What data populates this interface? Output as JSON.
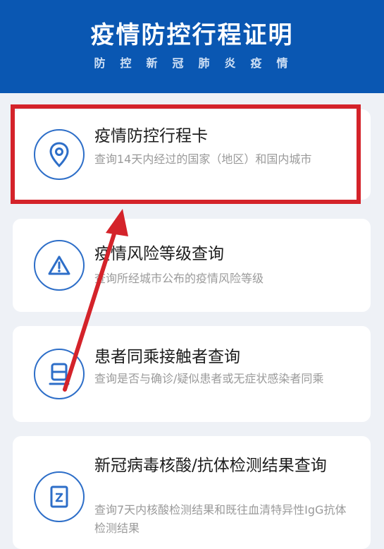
{
  "header": {
    "title": "疫情防控行程证明",
    "subtitle": "防控新冠肺炎疫情"
  },
  "cards": [
    {
      "title": "疫情防控行程卡",
      "desc": "查询14天内经过的国家（地区）和国内城市",
      "icon": "location-pin-icon"
    },
    {
      "title": "疫情风险等级查询",
      "desc": "查询所经城市公布的疫情风险等级",
      "icon": "warning-triangle-icon"
    },
    {
      "title": "患者同乘接触者查询",
      "desc": "查询是否与确诊/疑似患者或无症状感染者同乘",
      "icon": "train-icon"
    },
    {
      "title": "新冠病毒核酸/抗体检测结果查询",
      "desc": "查询7天内核酸检测结果和既往血清特异性IgG抗体检测结果",
      "icon": "test-report-icon"
    }
  ],
  "colors": {
    "header_bg": "#0a57b2",
    "icon_blue": "#2d6ec8",
    "highlight_red": "#d4232a"
  }
}
